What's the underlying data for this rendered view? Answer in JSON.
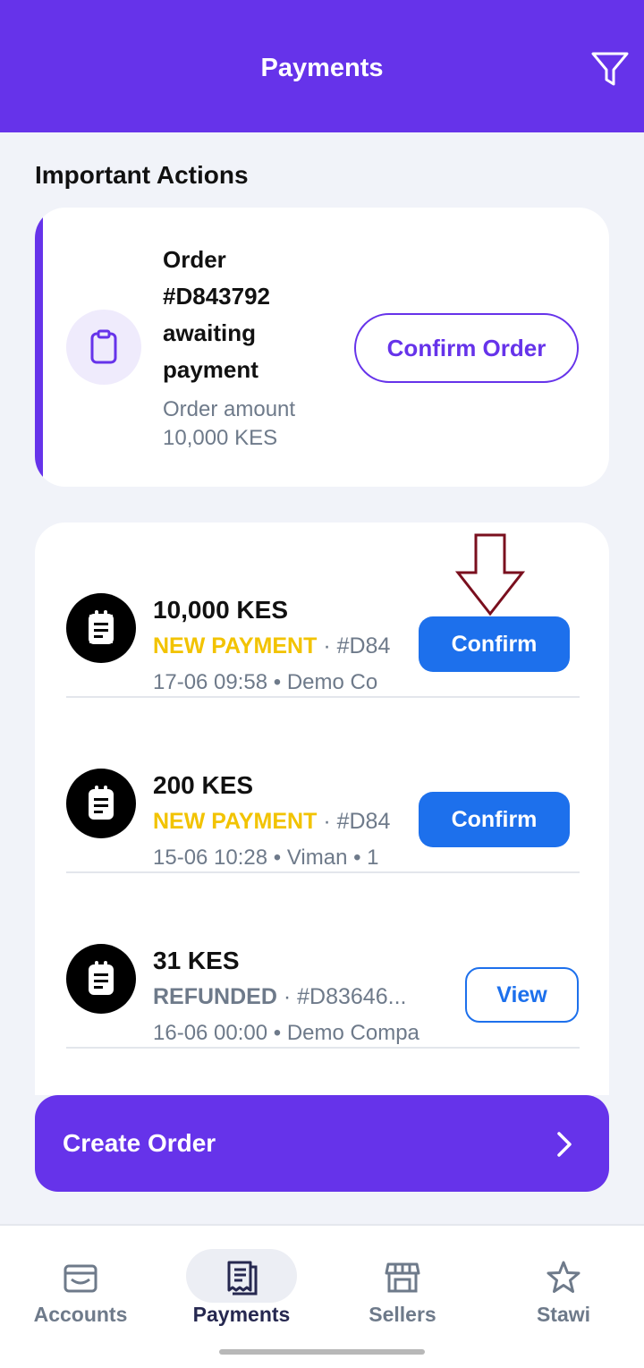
{
  "header": {
    "title": "Payments",
    "filter_icon": "filter-icon"
  },
  "important_actions": {
    "section_title": "Important Actions",
    "card": {
      "icon": "clipboard-icon",
      "headline_line1": "Order",
      "headline_line2": "#D843792",
      "headline_line3": "awaiting",
      "headline_line4": "payment",
      "amount_label": "Order amount",
      "amount_value": "10,000 KES",
      "button_label": "Confirm Order"
    }
  },
  "payments": [
    {
      "amount": "10,000 KES",
      "status": "NEW PAYMENT",
      "status_color": "#f2c300",
      "order": "#D84",
      "meta": "17-06 09:58 • Demo Co",
      "action": "Confirm",
      "icon": "receipt-icon"
    },
    {
      "amount": "200 KES",
      "status": "NEW PAYMENT",
      "status_color": "#f2c300",
      "order": "#D84",
      "meta": "15-06 10:28 • Viman • 1",
      "action": "Confirm",
      "icon": "receipt-icon"
    },
    {
      "amount": "31 KES",
      "status": "REFUNDED",
      "status_color": "#6e7a8a",
      "order": "#D83646...",
      "meta": "16-06 00:00 • Demo Compa",
      "action": "View",
      "icon": "receipt-icon"
    }
  ],
  "create_order": {
    "label": "Create Order",
    "icon": "chevron-right-icon"
  },
  "bottom_nav": {
    "items": [
      {
        "label": "Accounts",
        "icon": "wallet-icon",
        "active": false
      },
      {
        "label": "Payments",
        "icon": "receipt-icon",
        "active": true
      },
      {
        "label": "Sellers",
        "icon": "store-icon",
        "active": false
      },
      {
        "label": "Stawi",
        "icon": "star-icon",
        "active": false
      }
    ]
  },
  "colors": {
    "brand": "#6633ea",
    "action_blue": "#1d70ec",
    "new_payment": "#f2c300",
    "muted": "#6e7a8a",
    "annotation_arrow": "#7a0f1e"
  }
}
